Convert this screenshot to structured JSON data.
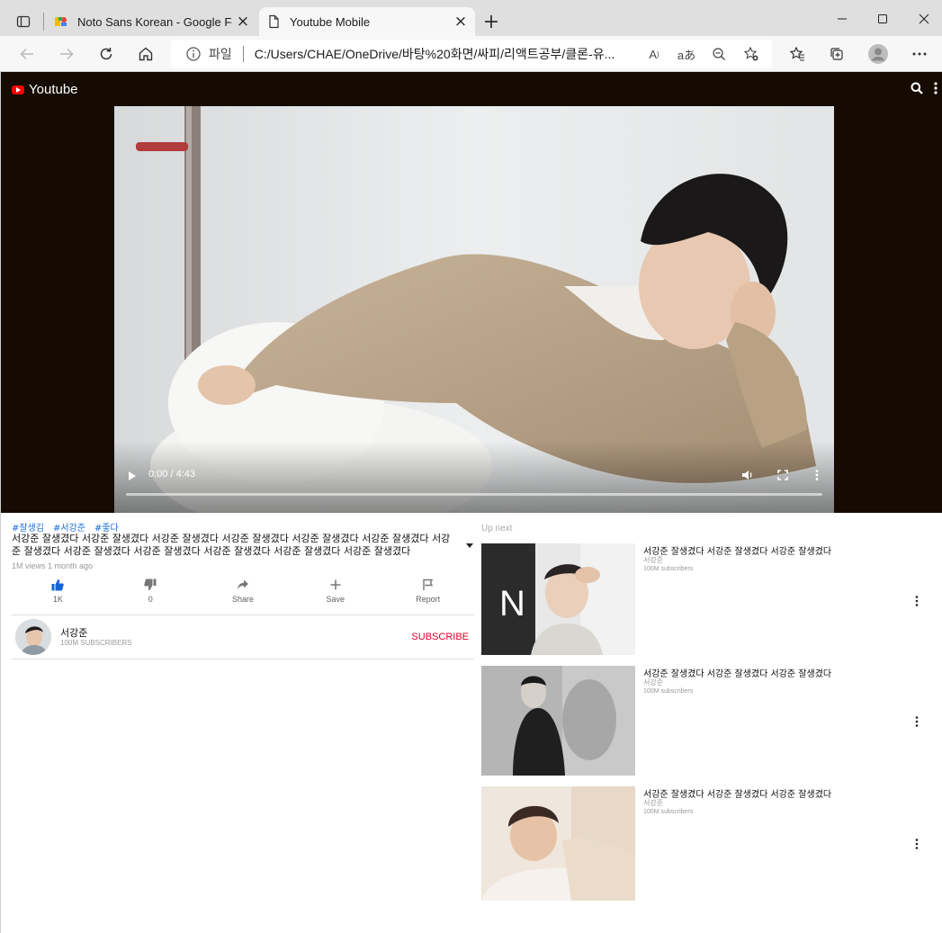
{
  "browser": {
    "tabs": [
      {
        "title": "Noto Sans Korean - Google Fonts",
        "active": false
      },
      {
        "title": "Youtube Mobile",
        "active": true
      }
    ],
    "address": {
      "scheme_label": "파일",
      "url": "C:/Users/CHAE/OneDrive/바탕%20화면/싸피/리액트공부/클론-유..."
    },
    "icons": [
      "tab-actions-icon",
      "back-icon",
      "forward-icon",
      "refresh-icon",
      "home-icon",
      "info-icon",
      "read-aloud-icon",
      "translate-icon",
      "zoom-out-icon",
      "add-favorite-icon",
      "favorites-icon",
      "collections-icon",
      "profile-icon",
      "more-icon",
      "minimize-icon",
      "maximize-icon",
      "close-icon"
    ],
    "read_aloud_label": "A",
    "translate_label": "aあ"
  },
  "app": {
    "logo_text": "Youtube",
    "brand_color": "#ff0000",
    "header_bg": "#150b00"
  },
  "player": {
    "time": "0:00 / 4:43",
    "progress": 0
  },
  "video": {
    "hashtags": [
      "#잘생김",
      "#서강준",
      "#좋다"
    ],
    "title": "서강준 잘생겼다 서강준 잘생겼다 서강준 잘생겼다 서강준 잘생겼다 서강준 잘생겼다 서강준 잘생겼다 서강준 잘생겼다 서강준 잘생겼다 서강준 잘생겼다 서강준 잘생겼다 서강준 잘생겼다 서강준 잘생겼다",
    "meta": "1M views 1 month ago",
    "actions": {
      "like": "1K",
      "dislike": "0",
      "share": "Share",
      "save": "Save",
      "report": "Report"
    }
  },
  "channel": {
    "name": "서강준",
    "subscribers": "100M SUBSCRIBERS",
    "subscribe_label": "SUBSCRIBE"
  },
  "upnext": {
    "label": "Up next",
    "items": [
      {
        "title": "서강준 잘생겼다 서강준 잘생겼다 서강준 잘생겼다",
        "channel": "서강준",
        "subs": "100M subscribers"
      },
      {
        "title": "서강준 잘생겼다 서강준 잘생겼다 서강준 잘생겼다",
        "channel": "서강준",
        "subs": "100M subscribers"
      },
      {
        "title": "서강준 잘생겼다 서강준 잘생겼다 서강준 잘생겼다",
        "channel": "서강준",
        "subs": "100M subscribers"
      }
    ]
  }
}
